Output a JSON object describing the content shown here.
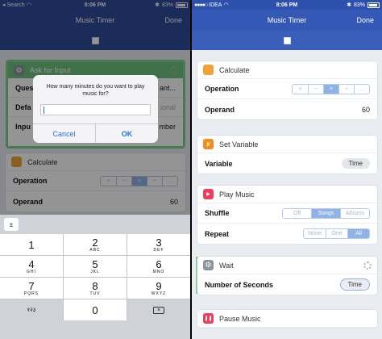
{
  "left": {
    "status": {
      "carrier": "Search",
      "time": "8:06 PM",
      "battery": "83%"
    },
    "nav": {
      "title": "Music Timer",
      "done": "Done"
    },
    "ask_card": {
      "title": "Ask for Input",
      "row1_label": "Ques",
      "row1_value": "ant...",
      "row2_label": "Defa",
      "row2_value": "ional",
      "row3_label": "Inpu",
      "row3_value": "mber"
    },
    "calc_card": {
      "title": "Calculate",
      "operation_label": "Operation",
      "operand_label": "Operand",
      "operand_value": "60"
    },
    "alert": {
      "message": "How many minutes do you want to play music for?",
      "cancel": "Cancel",
      "ok": "OK"
    },
    "keyboard": {
      "mini": "±",
      "keys": [
        {
          "d": "1",
          "l": ""
        },
        {
          "d": "2",
          "l": "ABC"
        },
        {
          "d": "3",
          "l": "DEF"
        },
        {
          "d": "4",
          "l": "GHI"
        },
        {
          "d": "5",
          "l": "JKL"
        },
        {
          "d": "6",
          "l": "MNO"
        },
        {
          "d": "7",
          "l": "PQRS"
        },
        {
          "d": "8",
          "l": "TUV"
        },
        {
          "d": "9",
          "l": "WXYZ"
        }
      ],
      "bottom_left": "१२३",
      "zero": "0"
    }
  },
  "right": {
    "status": {
      "carrier": "IDEA",
      "time": "8:06 PM",
      "battery": "83%"
    },
    "nav": {
      "title": "Music Timer",
      "done": "Done"
    },
    "calculate": {
      "title": "Calculate",
      "operation_label": "Operation",
      "operators": [
        "+",
        "−",
        "×",
        "÷",
        "…"
      ],
      "operand_label": "Operand",
      "operand_value": "60"
    },
    "set_variable": {
      "title": "Set Variable",
      "variable_label": "Variable",
      "variable_value": "Time"
    },
    "play_music": {
      "title": "Play Music",
      "shuffle_label": "Shuffle",
      "shuffle_options": [
        "Off",
        "Songs",
        "Albums"
      ],
      "repeat_label": "Repeat",
      "repeat_options": [
        "None",
        "One",
        "All"
      ]
    },
    "wait": {
      "title": "Wait",
      "seconds_label": "Number of Seconds",
      "seconds_value": "Time"
    },
    "pause_music": {
      "title": "Pause Music"
    }
  }
}
